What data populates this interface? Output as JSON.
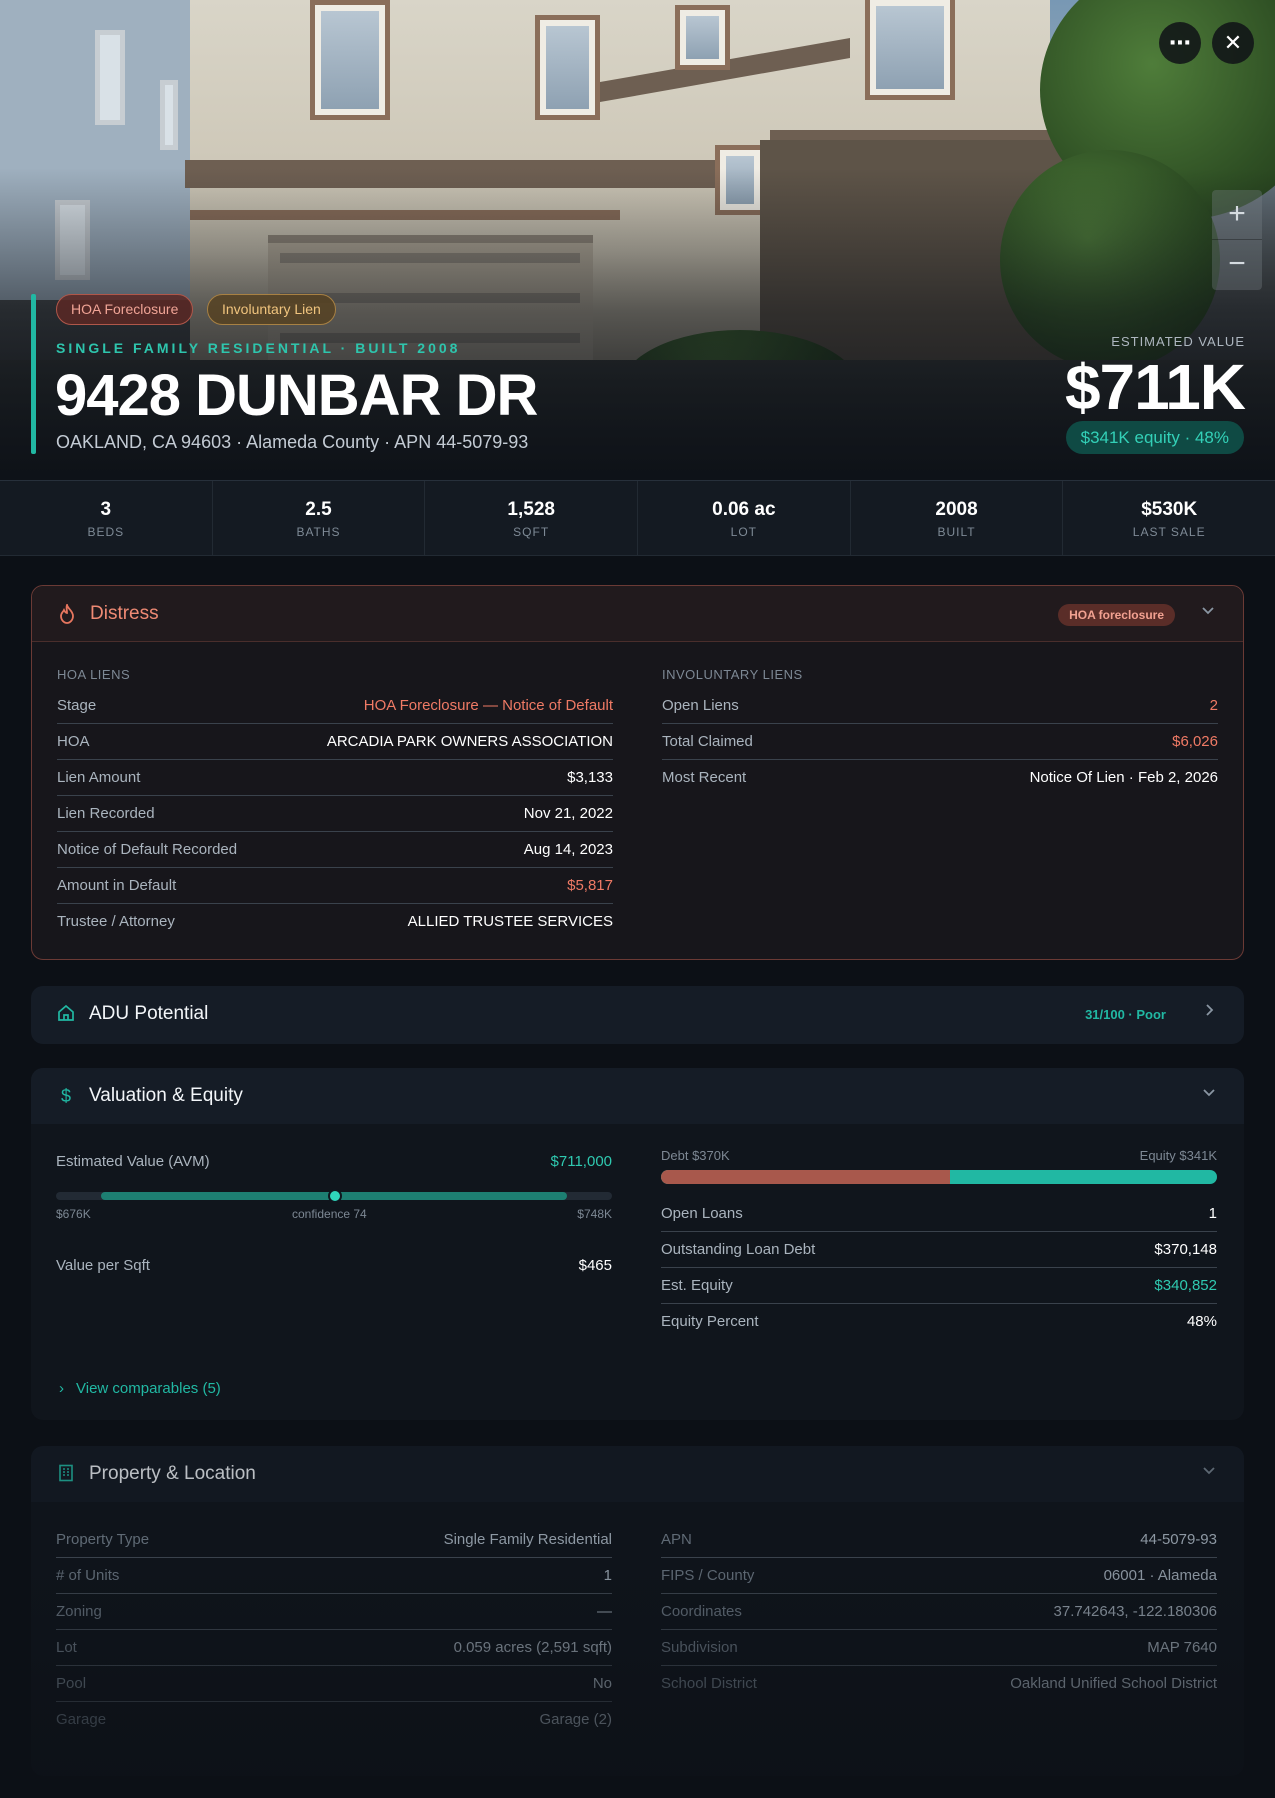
{
  "hero": {
    "badges": {
      "hoa": "HOA Foreclosure",
      "lien": "Involuntary Lien"
    },
    "kicker": "SINGLE FAMILY RESIDENTIAL · BUILT 2008",
    "address": "9428 DUNBAR DR",
    "subline": "OAKLAND, CA 94603 · Alameda County · APN 44-5079-93",
    "value_label": "ESTIMATED VALUE",
    "value": "$711K",
    "equity": "$341K equity · 48%"
  },
  "controls": {
    "more": "⋯",
    "close": "✕",
    "zoom_in": "+",
    "zoom_out": "−"
  },
  "stats": [
    {
      "value": "3",
      "label": "BEDS"
    },
    {
      "value": "2.5",
      "label": "BATHS"
    },
    {
      "value": "1,528",
      "label": "SQFT"
    },
    {
      "value": "0.06 ac",
      "label": "LOT"
    },
    {
      "value": "2008",
      "label": "BUILT"
    },
    {
      "value": "$530K",
      "label": "LAST SALE"
    }
  ],
  "distress": {
    "title": "Distress",
    "badge": "HOA foreclosure",
    "icon": "flame-icon",
    "hoa_label": "HOA LIENS",
    "hoa_rows": [
      {
        "k": "Stage",
        "v": "HOA Foreclosure — Notice of Default"
      },
      {
        "k": "HOA",
        "v": "ARCADIA PARK OWNERS ASSOCIATION"
      },
      {
        "k": "Lien Amount",
        "v": "$3,133"
      },
      {
        "k": "Lien Recorded",
        "v": "Nov 21, 2022"
      },
      {
        "k": "Notice of Default Recorded",
        "v": "Aug 14, 2023"
      },
      {
        "k": "Amount in Default",
        "v": "$5,817"
      },
      {
        "k": "Trustee / Attorney",
        "v": "ALLIED TRUSTEE SERVICES"
      }
    ],
    "inv_label": "INVOLUNTARY LIENS",
    "inv_rows": [
      {
        "k": "Open Liens",
        "v": "2"
      },
      {
        "k": "Total Claimed",
        "v": "$6,026"
      },
      {
        "k": "Most Recent",
        "v": "Notice Of Lien · Feb 2, 2026"
      }
    ]
  },
  "adu": {
    "title": "ADU Potential",
    "score": "31/100 · Poor",
    "icon": "home-icon"
  },
  "valuation": {
    "title": "Valuation & Equity",
    "icon": "dollar-icon",
    "avm_label": "Estimated Value (AVM)",
    "avm_value": "$711,000",
    "range_low": "$676K",
    "range_high": "$748K",
    "confidence": "confidence 74",
    "per_sqft_label": "Value per Sqft",
    "per_sqft": "$465",
    "debt_label": "Debt $370K",
    "equity_label": "Equity $341K",
    "debt_fraction": 0.52,
    "rows": [
      {
        "k": "Open Loans",
        "v": "1"
      },
      {
        "k": "Outstanding Loan Debt",
        "v": "$370,148"
      },
      {
        "k": "Est. Equity",
        "v": "$340,852"
      },
      {
        "k": "Equity Percent",
        "v": "48%"
      }
    ],
    "comps": "View comparables (5)"
  },
  "property": {
    "title": "Property & Location",
    "icon": "building-icon",
    "left": [
      {
        "k": "Property Type",
        "v": "Single Family Residential"
      },
      {
        "k": "# of Units",
        "v": "1"
      },
      {
        "k": "Zoning",
        "v": "—"
      },
      {
        "k": "Lot",
        "v": "0.059 acres (2,591 sqft)"
      },
      {
        "k": "Pool",
        "v": "No"
      },
      {
        "k": "Garage",
        "v": "Garage (2)"
      }
    ],
    "right": [
      {
        "k": "APN",
        "v": "44-5079-93"
      },
      {
        "k": "FIPS / County",
        "v": "06001 · Alameda"
      },
      {
        "k": "Coordinates",
        "v": "37.742643, -122.180306"
      },
      {
        "k": "Subdivision",
        "v": "MAP 7640"
      },
      {
        "k": "School District",
        "v": "Oakland Unified School District"
      }
    ]
  },
  "colors": {
    "accent": "#21b8a3",
    "danger": "#ef7a65",
    "debt": "#a8584c"
  }
}
